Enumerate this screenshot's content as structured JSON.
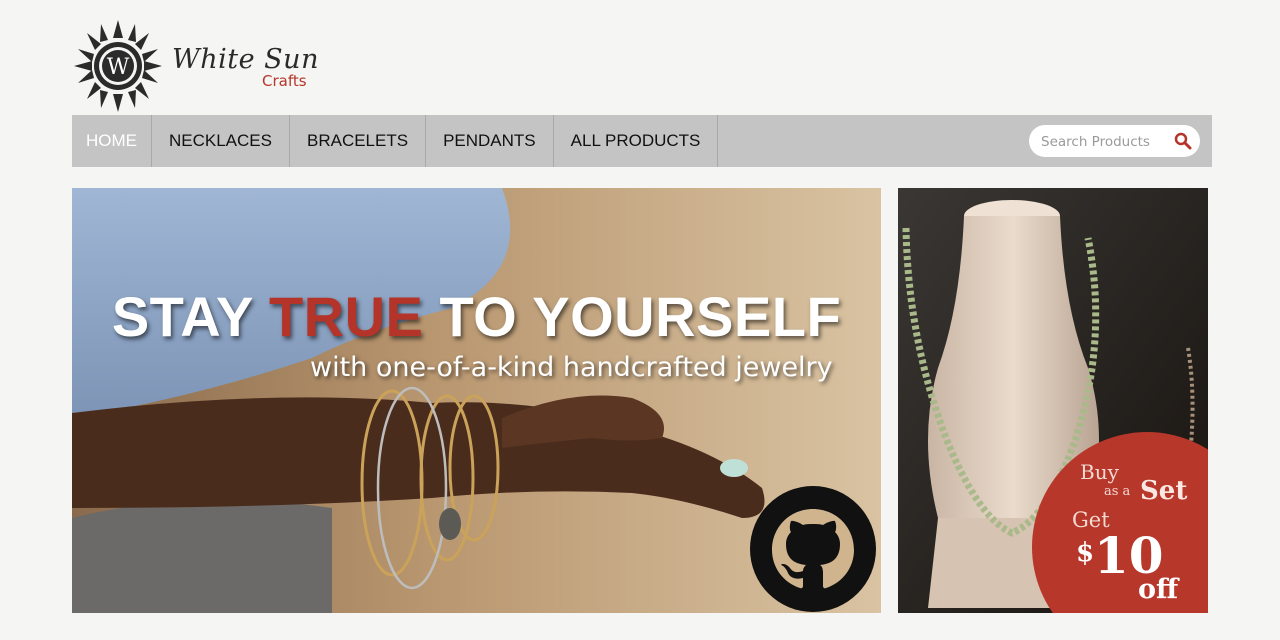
{
  "brand": {
    "name": "White Sun",
    "sub": "Crafts",
    "logo_letter": "W"
  },
  "nav": {
    "items": [
      {
        "label": "HOME",
        "active": true
      },
      {
        "label": "NECKLACES",
        "active": false
      },
      {
        "label": "BRACELETS",
        "active": false
      },
      {
        "label": "PENDANTS",
        "active": false
      },
      {
        "label": "ALL PRODUCTS",
        "active": false
      }
    ]
  },
  "search": {
    "placeholder": "Search Products",
    "value": "",
    "icon": "search-icon"
  },
  "hero": {
    "title_part1": "STAY ",
    "title_accent": "TRUE",
    "title_part2": " TO YOURSELF",
    "subtitle": "with one-of-a-kind handcrafted jewelry",
    "corner_icon": "github-icon"
  },
  "promo": {
    "buy": "Buy",
    "as_a": "as a",
    "set": "Set",
    "get": "Get",
    "currency": "$",
    "amount": "10",
    "off": "off"
  },
  "colors": {
    "accent": "#b4342a",
    "nav_bg": "#c4c4c4",
    "page_bg": "#f5f5f3"
  }
}
